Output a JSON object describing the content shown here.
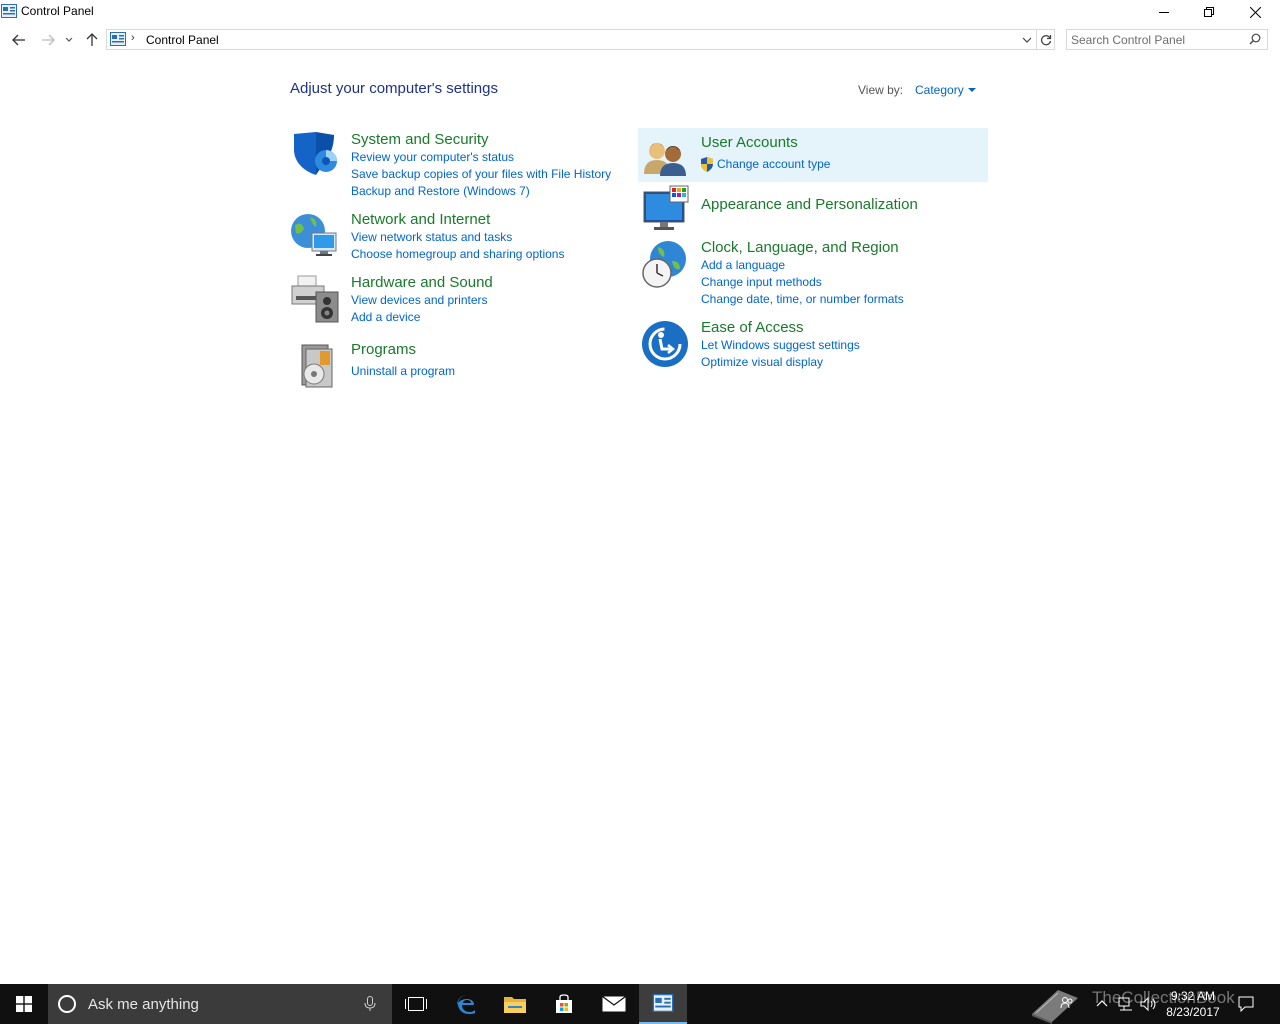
{
  "window": {
    "title": "Control Panel"
  },
  "address": {
    "path": "Control Panel",
    "separator": "›"
  },
  "search": {
    "placeholder": "Search Control Panel"
  },
  "main": {
    "heading": "Adjust your computer's settings",
    "view_by_label": "View by:",
    "view_by_value": "Category",
    "categories": [
      {
        "title": "System and Security",
        "icon": "shield-icon",
        "links": [
          "Review your computer's status",
          "Save backup copies of your files with File History",
          "Backup and Restore (Windows 7)"
        ]
      },
      {
        "title": "Network and Internet",
        "icon": "network-globe-icon",
        "links": [
          "View network status and tasks",
          "Choose homegroup and sharing options"
        ]
      },
      {
        "title": "Hardware and Sound",
        "icon": "printer-speaker-icon",
        "links": [
          "View devices and printers",
          "Add a device"
        ]
      },
      {
        "title": "Programs",
        "icon": "programs-disc-icon",
        "links": [
          "Uninstall a program"
        ]
      },
      {
        "title": "User Accounts",
        "icon": "users-icon",
        "links": [
          "Change account type"
        ]
      },
      {
        "title": "Appearance and Personalization",
        "icon": "monitor-palette-icon",
        "links": []
      },
      {
        "title": "Clock, Language, and Region",
        "icon": "clock-globe-icon",
        "links": [
          "Add a language",
          "Change input methods",
          "Change date, time, or number formats"
        ]
      },
      {
        "title": "Ease of Access",
        "icon": "ease-of-access-icon",
        "links": [
          "Let Windows suggest settings",
          "Optimize visual display"
        ]
      }
    ]
  },
  "taskbar": {
    "cortana_text": "Ask me anything",
    "time": "9:32 AM",
    "date": "8/23/2017",
    "watermark": "TheCollectionBook",
    "pinned": [
      "task-view-icon",
      "edge-icon",
      "file-explorer-icon",
      "store-icon",
      "mail-icon",
      "control-panel-icon"
    ]
  },
  "colors": {
    "heading": "#1e3287",
    "category_title": "#1a7a2c",
    "link": "#0066cc",
    "hover_highlight": "#e5f3fb",
    "taskbar": "#101010"
  }
}
